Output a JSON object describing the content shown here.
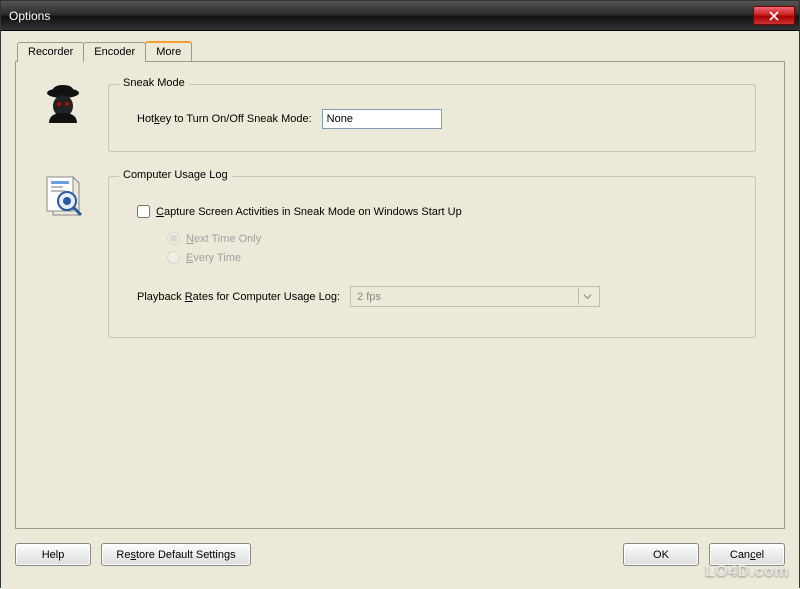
{
  "window": {
    "title": "Options"
  },
  "tabs": [
    {
      "label": "Recorder"
    },
    {
      "label": "Encoder"
    },
    {
      "label": "More"
    }
  ],
  "sneak": {
    "legend": "Sneak Mode",
    "hotkey_pre": "Hot",
    "hotkey_u": "k",
    "hotkey_post": "ey to Turn On/Off Sneak Mode:",
    "value": "None"
  },
  "usage": {
    "legend": "Computer Usage Log",
    "capture_u": "C",
    "capture_post": "apture Screen Activities in Sneak Mode on Windows Start Up",
    "radio1_u": "N",
    "radio1_post": "ext Time Only",
    "radio2_u": "E",
    "radio2_post": "very Time",
    "rate_pre": "Playback ",
    "rate_u": "R",
    "rate_post": "ates for Computer Usage Log:",
    "rate_value": "2 fps"
  },
  "buttons": {
    "help": "Help",
    "restore_pre": "Re",
    "restore_u": "s",
    "restore_post": "tore Default Settings",
    "ok": "OK",
    "cancel_pre": "Can",
    "cancel_u": "c",
    "cancel_post": "el"
  },
  "watermark": "LO4D.com"
}
